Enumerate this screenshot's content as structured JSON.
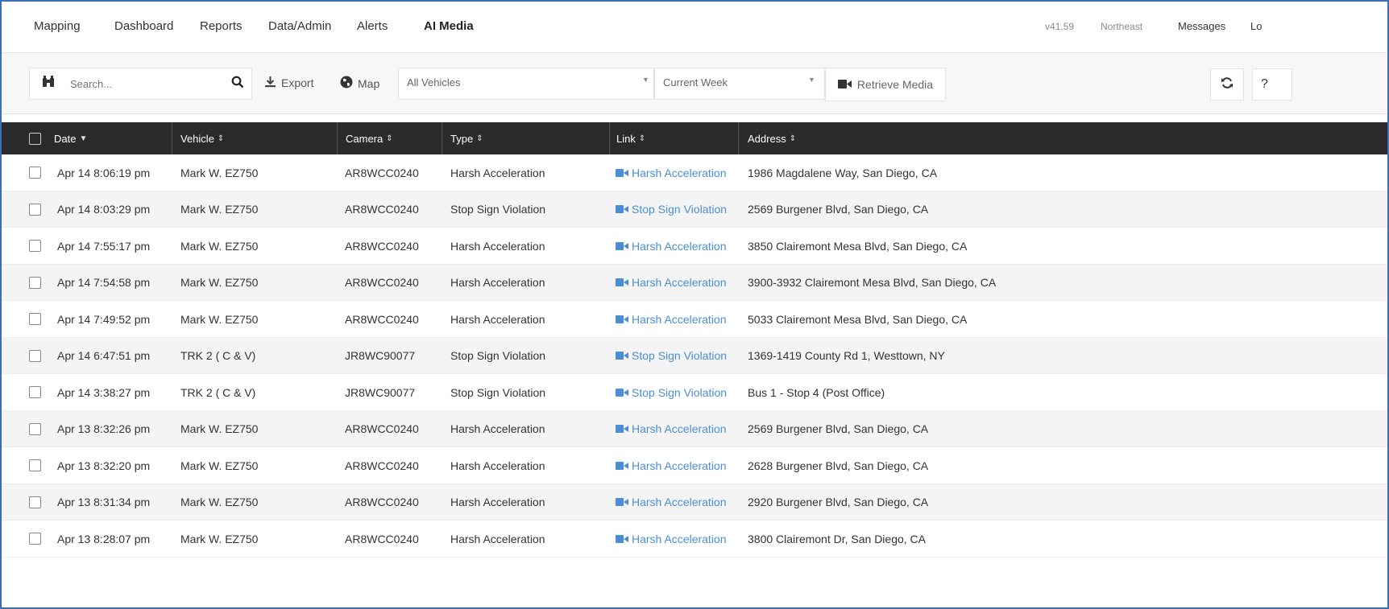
{
  "nav": {
    "items": [
      "Mapping",
      "Dashboard",
      "Reports",
      "Data/Admin",
      "Alerts",
      "AI Media"
    ],
    "version": "v41.59",
    "region": "Northeast",
    "messages": "Messages",
    "logout_partial": "Lo"
  },
  "toolbar": {
    "search_placeholder": "Search...",
    "export_label": "Export",
    "map_label": "Map",
    "vehicle_select": "All Vehicles",
    "period_select": "Current Week",
    "retrieve_label": "Retrieve Media",
    "help_partial": "?"
  },
  "table": {
    "headers": {
      "date": "Date",
      "vehicle": "Vehicle",
      "camera": "Camera",
      "type": "Type",
      "link": "Link",
      "address": "Address"
    },
    "rows": [
      {
        "date": "Apr 14 8:06:19 pm",
        "vehicle": "Mark W. EZ750",
        "camera": "AR8WCC0240",
        "type": "Harsh Acceleration",
        "link": "Harsh Acceleration",
        "address": "1986 Magdalene Way, San Diego, CA"
      },
      {
        "date": "Apr 14 8:03:29 pm",
        "vehicle": "Mark W. EZ750",
        "camera": "AR8WCC0240",
        "type": "Stop Sign Violation",
        "link": "Stop Sign Violation",
        "address": "2569 Burgener Blvd, San Diego, CA"
      },
      {
        "date": "Apr 14 7:55:17 pm",
        "vehicle": "Mark W. EZ750",
        "camera": "AR8WCC0240",
        "type": "Harsh Acceleration",
        "link": "Harsh Acceleration",
        "address": "3850 Clairemont Mesa Blvd, San Diego, CA"
      },
      {
        "date": "Apr 14 7:54:58 pm",
        "vehicle": "Mark W. EZ750",
        "camera": "AR8WCC0240",
        "type": "Harsh Acceleration",
        "link": "Harsh Acceleration",
        "address": "3900-3932 Clairemont Mesa Blvd, San Diego, CA"
      },
      {
        "date": "Apr 14 7:49:52 pm",
        "vehicle": "Mark W. EZ750",
        "camera": "AR8WCC0240",
        "type": "Harsh Acceleration",
        "link": "Harsh Acceleration",
        "address": "5033 Clairemont Mesa Blvd, San Diego, CA"
      },
      {
        "date": "Apr 14 6:47:51 pm",
        "vehicle": "TRK 2 ( C & V)",
        "camera": "JR8WC90077",
        "type": "Stop Sign Violation",
        "link": "Stop Sign Violation",
        "address": "1369-1419 County Rd 1, Westtown, NY"
      },
      {
        "date": "Apr 14 3:38:27 pm",
        "vehicle": "TRK 2 ( C & V)",
        "camera": "JR8WC90077",
        "type": "Stop Sign Violation",
        "link": "Stop Sign Violation",
        "address": "Bus 1 - Stop 4 (Post Office)"
      },
      {
        "date": "Apr 13 8:32:26 pm",
        "vehicle": "Mark W. EZ750",
        "camera": "AR8WCC0240",
        "type": "Harsh Acceleration",
        "link": "Harsh Acceleration",
        "address": "2569 Burgener Blvd, San Diego, CA"
      },
      {
        "date": "Apr 13 8:32:20 pm",
        "vehicle": "Mark W. EZ750",
        "camera": "AR8WCC0240",
        "type": "Harsh Acceleration",
        "link": "Harsh Acceleration",
        "address": "2628 Burgener Blvd, San Diego, CA"
      },
      {
        "date": "Apr 13 8:31:34 pm",
        "vehicle": "Mark W. EZ750",
        "camera": "AR8WCC0240",
        "type": "Harsh Acceleration",
        "link": "Harsh Acceleration",
        "address": "2920 Burgener Blvd, San Diego, CA"
      },
      {
        "date": "Apr 13 8:28:07 pm",
        "vehicle": "Mark W. EZ750",
        "camera": "AR8WCC0240",
        "type": "Harsh Acceleration",
        "link": "Harsh Acceleration",
        "address": "3800 Clairemont Dr, San Diego, CA"
      }
    ]
  },
  "icons": {
    "binoculars": "binoculars-icon",
    "search": "search-icon",
    "export": "download-icon",
    "map": "globe-icon",
    "video": "video-camera-icon",
    "refresh": "refresh-icon"
  },
  "colors": {
    "link": "#4a8fd6",
    "header_bg": "#2b2b2b",
    "frame": "#3a6fb5"
  }
}
